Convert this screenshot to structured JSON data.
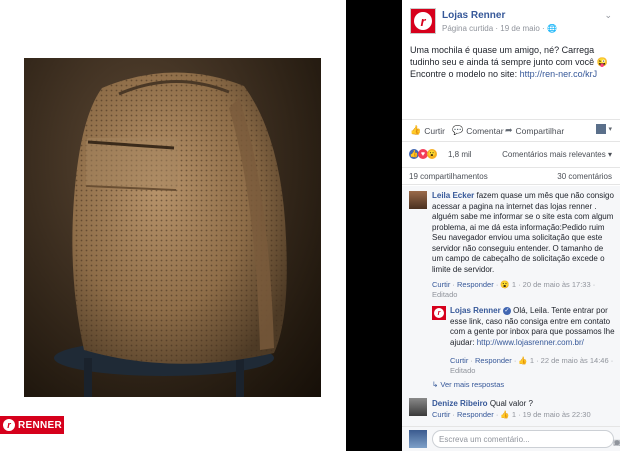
{
  "brand": {
    "logo_text": "RENNER",
    "logo_mark": "r"
  },
  "post": {
    "page_name": "Lojas Renner",
    "meta": "Página curtida · 19 de maio ·",
    "caption_text": "Uma mochila é quase um amigo, né? Carrega tudinho seu e ainda tá sempre junto com você 😜 Encontre o modelo no site: ",
    "caption_link": "http://ren-ner.co/krJ",
    "actions": {
      "like": "Curtir",
      "comment": "Comentar",
      "share": "Compartilhar"
    },
    "reaction_count": "1,8 mil",
    "relevance": "Comentários mais relevantes ▾",
    "shares": "19 compartilhamentos",
    "comments_count": "30 comentários"
  },
  "comments": [
    {
      "author": "Leila Ecker",
      "text": "fazem quase um mês que não consigo acessar a pagina na internet das lojas renner . alguém sabe me informar se o site esta com algum problema, ai me dá esta informação:Pedido ruim Seu navegador enviou uma solicitação que este servidor não conseguiu entender. O tamanho de um campo de cabeçalho de solicitação excede o limite de servidor.",
      "meta_like": "Curtir",
      "meta_reply": "Responder",
      "meta_rest": "· 😮 1 · 20 de maio às 17:33 · Editado"
    },
    {
      "author": "Lojas Renner",
      "text": "Olá, Leila. Tente entrar por esse link, caso não consiga entre em contato com a gente por inbox para que possamos lhe ajudar: ",
      "link": "http://www.lojasrenner.com.br/",
      "meta_like": "Curtir",
      "meta_reply": "Responder",
      "meta_rest": "· 👍 1 · 22 de maio às 14:46 · Editado"
    },
    {
      "more_replies": "↳ Ver mais respostas"
    },
    {
      "author": "Denize Ribeiro",
      "text": "Qual valor ?",
      "meta_like": "Curtir",
      "meta_reply": "Responder",
      "meta_rest": "· 👍 1 · 19 de maio às 22:30"
    }
  ],
  "composer": {
    "placeholder": "Escreva um comentário..."
  },
  "colors": {
    "brand_red": "#d6001c",
    "link_blue": "#365899",
    "divider": "#000000"
  }
}
